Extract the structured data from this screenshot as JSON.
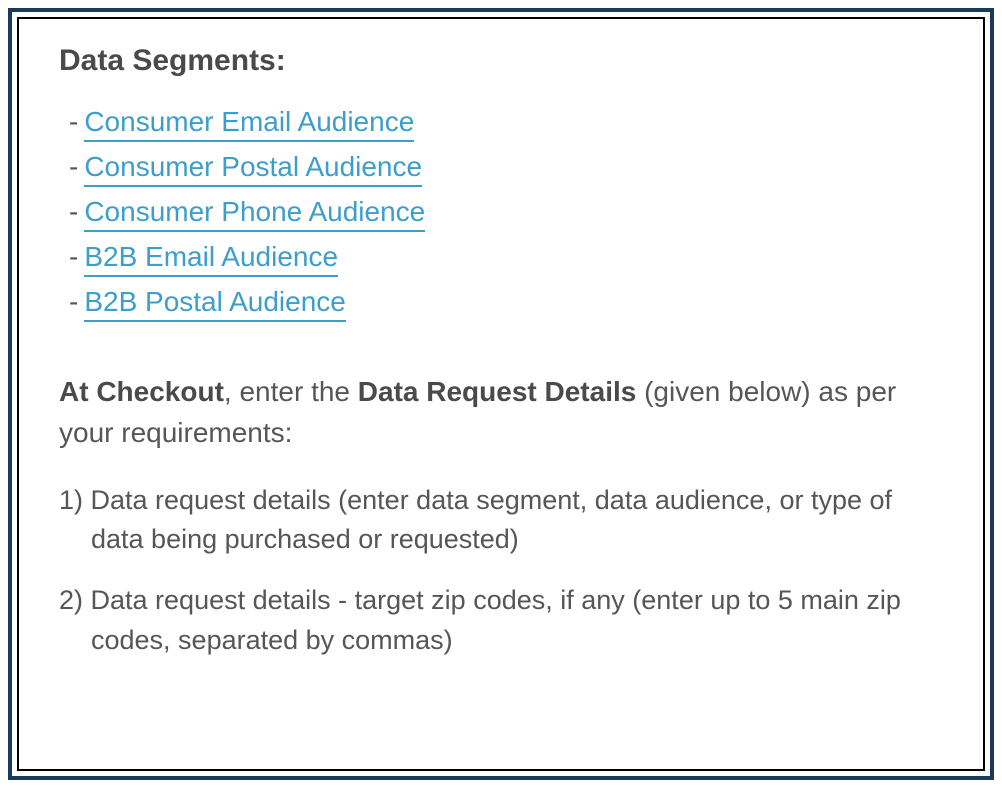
{
  "heading": "Data Segments:",
  "segments": [
    "Consumer Email Audience",
    "Consumer Postal Audience",
    "Consumer Phone Audience",
    "B2B Email Audience",
    "B2B Postal Audience"
  ],
  "checkout": {
    "bold1": "At Checkout",
    "text1": ", enter the ",
    "bold2": "Data Request Details",
    "text2": " (given below) as per your requirements:"
  },
  "items": [
    "1) Data request details (enter data segment, data audience, or type of data being purchased or requested)",
    "2) Data request details - target zip codes, if any (enter up to 5 main zip codes, separated by commas)"
  ]
}
